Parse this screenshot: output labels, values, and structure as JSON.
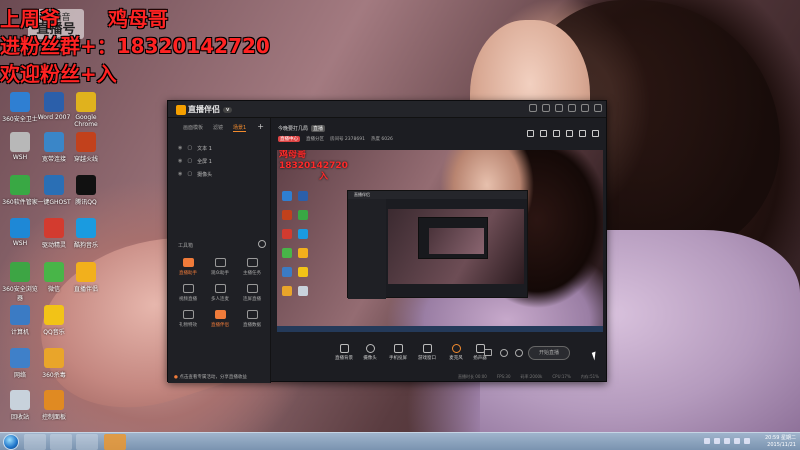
{
  "overlay": {
    "line1_prefix": "上周爷",
    "line1_name": "鸡母哥",
    "line2": "进粉丝群+：18320142720",
    "line3": "欢迎粉丝+入"
  },
  "site_logo": {
    "top": "YY语音",
    "main": "直播号",
    "id": "3709"
  },
  "desktop_icons": [
    {
      "label": "360安全卫士",
      "color": "#2f7fd2"
    },
    {
      "label": "Word 2007",
      "color": "#2b5faa"
    },
    {
      "label": "Google Chrome",
      "color": "#e0b21d"
    },
    {
      "label": "WSH",
      "color": "#b8b8b8"
    },
    {
      "label": "宽带连接",
      "color": "#3a86c8"
    },
    {
      "label": "穿越火线",
      "color": "#c2411c"
    },
    {
      "label": "360软件管家",
      "color": "#39a844"
    },
    {
      "label": "一键GHOST",
      "color": "#2a6fb5"
    },
    {
      "label": "腾讯QQ",
      "color": "#111111"
    },
    {
      "label": "WSH",
      "color": "#1e88d6"
    },
    {
      "label": "驱动精灵",
      "color": "#d33b2f"
    },
    {
      "label": "酷狗音乐",
      "color": "#1a9be0"
    },
    {
      "label": "360安全浏览器",
      "color": "#3da544"
    },
    {
      "label": "微信",
      "color": "#48b548"
    },
    {
      "label": "直播伴侣",
      "color": "#f2b01c"
    },
    {
      "label": "计算机",
      "color": "#3b7bc4"
    },
    {
      "label": "QQ音乐",
      "color": "#f2c317"
    },
    {
      "label": "网络",
      "color": "#3f80c9"
    },
    {
      "label": "360杀毒",
      "color": "#e9a52a"
    },
    {
      "label": "回收站",
      "color": "#c8d2dc"
    },
    {
      "label": "控制面板",
      "color": "#e08a22"
    }
  ],
  "app": {
    "title": "直播伴侣",
    "version_badge": "v",
    "left_tabs": [
      "画面模板",
      "滤镜",
      "场景1"
    ],
    "scenes": [
      "文本 1",
      "全屏 1",
      "摄像头"
    ],
    "tools_header": "工具箱",
    "tools": [
      {
        "label": "直播助手",
        "hot": true
      },
      {
        "label": "观众助手",
        "hot": false
      },
      {
        "label": "主播任务",
        "hot": false
      },
      {
        "label": "视频直播",
        "hot": false
      },
      {
        "label": "多人连麦",
        "hot": false
      },
      {
        "label": "连屏直播",
        "hot": false
      },
      {
        "label": "礼物特效",
        "hot": false
      },
      {
        "label": "直播伴侣",
        "hot": true
      },
      {
        "label": "直播数据",
        "hot": false
      }
    ],
    "footer_text": "点击查看专属活动，分享直播收益",
    "room_title": "今晚要打几局",
    "room_tag": "直播",
    "room_info": [
      "直播中心",
      "直播分区",
      "房间号 2378691",
      "热度 6026"
    ],
    "preview_text": [
      "鸡母哥",
      "18320142720",
      "入"
    ],
    "nested_title": "直播伴侣",
    "controls": [
      "直播背景",
      "摄像头",
      "手机投屏",
      "游戏窗口",
      "麦克风",
      "扬声器"
    ],
    "start_button": "开始直播",
    "status": [
      "直播时长 00:00",
      "FPS:30",
      "码率:2000k",
      "CPU:17%",
      "内存:51%"
    ]
  },
  "taskbar": {
    "time": "20:59 星期二",
    "date": "2015/11/21"
  }
}
